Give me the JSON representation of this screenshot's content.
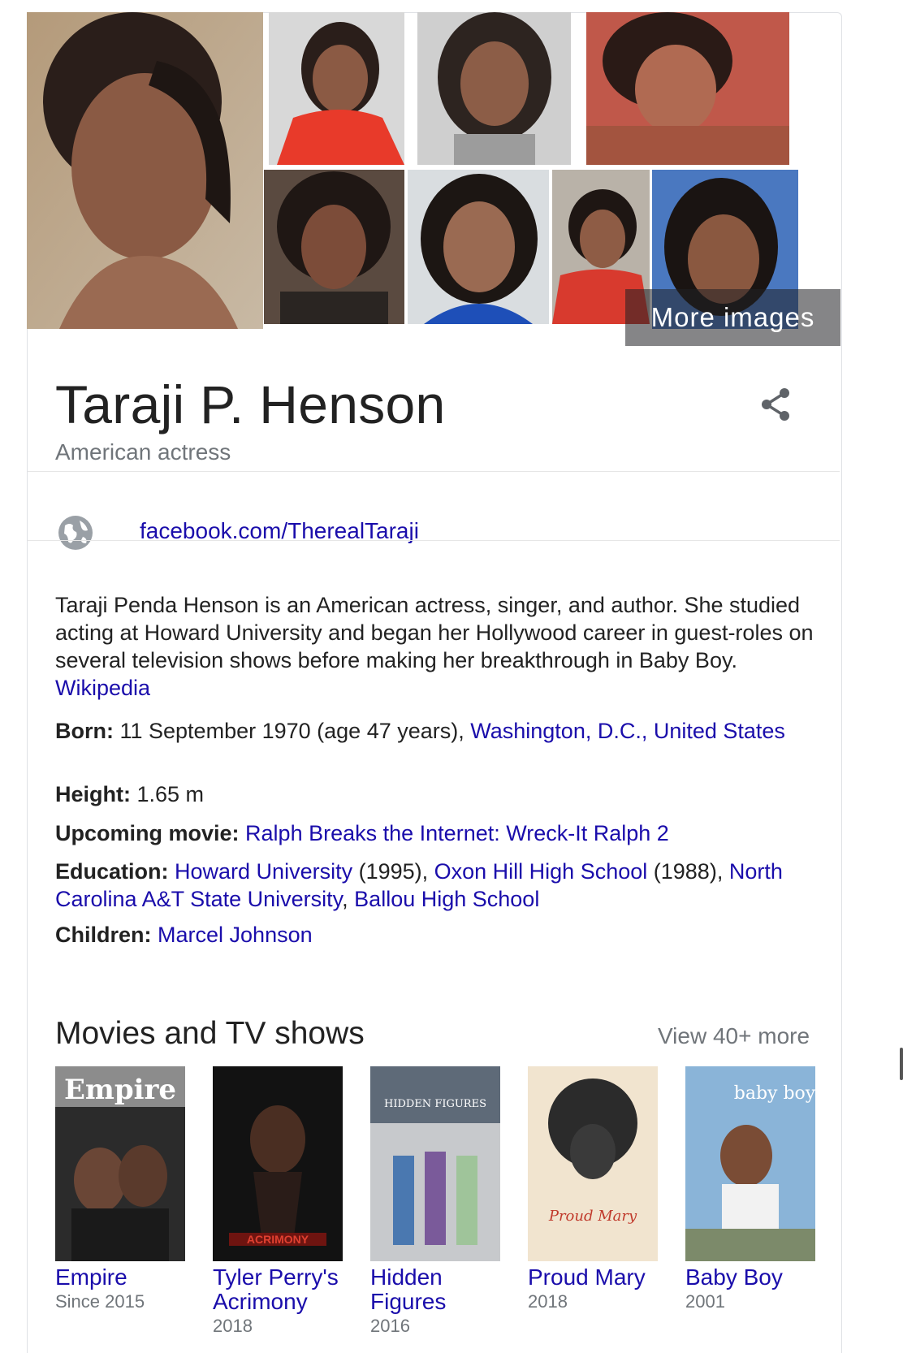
{
  "knowledge_panel": {
    "images_overlay_label": "More images",
    "title": "Taraji P. Henson",
    "subtitle": "American actress",
    "website": "facebook.com/TherealTaraji",
    "description": {
      "text": "Taraji Penda Henson is an American actress, singer, and author. She studied acting at Howard University and began her Hollywood career in guest-roles on several television shows before making her breakthrough in Baby Boy. ",
      "source_link": "Wikipedia"
    },
    "facts": {
      "born": {
        "label": "Born:",
        "text": " 11 September 1970 (age 47 years), ",
        "place_link": "Washington, D.C., United States"
      },
      "height": {
        "label": "Height:",
        "text": " 1.65 m"
      },
      "upcoming_movie": {
        "label": "Upcoming movie:",
        "link": "Ralph Breaks the Internet: Wreck-It Ralph 2"
      },
      "education": {
        "label": "Education:",
        "school1": "Howard University",
        "year1": " (1995), ",
        "school2": "Oxon Hill High School",
        "year2": " (1988), ",
        "school3": "North Carolina A&T State University",
        "sep3": ", ",
        "school4": "Ballou High School"
      },
      "children": {
        "label": "Children:",
        "link": "Marcel Johnson"
      }
    },
    "movies_section": {
      "title": "Movies and TV shows",
      "view_more": "View 40+ more",
      "items": [
        {
          "title": "Empire",
          "year": "Since 2015",
          "poster_text": "Empire"
        },
        {
          "title": "Tyler Perry's Acrimony",
          "year": "2018",
          "poster_text": "ACRIMONY"
        },
        {
          "title": "Hidden Figures",
          "year": "2016",
          "poster_text": "HIDDEN FIGURES"
        },
        {
          "title": "Proud Mary",
          "year": "2018",
          "poster_text": "Proud Mary"
        },
        {
          "title": "Baby Boy",
          "year": "2001",
          "poster_text": "baby boy"
        }
      ]
    },
    "colors": {
      "link": "#1a0dab",
      "secondary_text": "#70757a",
      "divider": "#e6e6e6"
    },
    "icons": {
      "share": "share-icon",
      "website": "globe-icon"
    }
  }
}
